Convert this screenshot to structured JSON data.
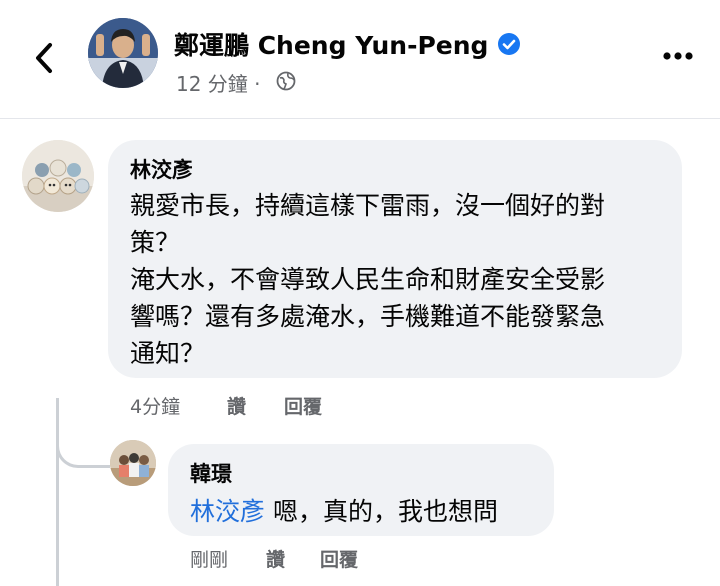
{
  "header": {
    "author_name": "鄭運鵬 Cheng Yun-Peng",
    "post_time": "12 分鐘",
    "separator": "·",
    "back_icon": "chevron-left-icon",
    "verified_icon": "verified-badge-icon",
    "privacy_icon": "globe-icon",
    "more_icon": "more-options-icon"
  },
  "comments": [
    {
      "author": "林洨彥",
      "lines": [
        "親愛市長，持續這樣下雷雨，沒一個好的對",
        "策？",
        "淹大水，不會導致人民生命和財產安全受影",
        "響嗎？還有多處淹水，手機難道不能發緊急",
        "通知？"
      ],
      "time": "4分鐘",
      "like_label": "讚",
      "reply_label": "回覆"
    }
  ],
  "reply": {
    "author": "韓璟",
    "mention": "林洨彥",
    "text": " 嗯，真的，我也想問",
    "time": "剛剛",
    "like_label": "讚",
    "reply_label": "回覆"
  },
  "colors": {
    "bubble": "#f0f2f5",
    "mention": "#216fdb",
    "verified": "#1877f2",
    "secondary_text": "#65676b"
  }
}
